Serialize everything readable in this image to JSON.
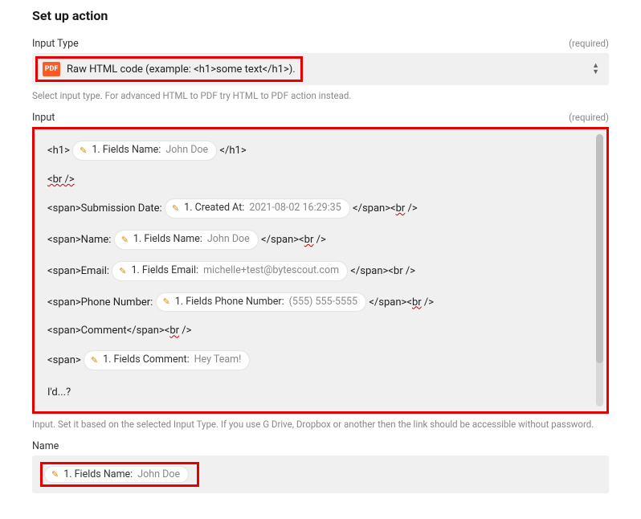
{
  "header": {
    "title": "Set up action"
  },
  "inputType": {
    "label": "Input Type",
    "required": "(required)",
    "badge": "PDF",
    "value": "Raw HTML code (example: <h1>some text</h1>).",
    "helper_pre": "Select input type. For advanced HTML to PDF try ",
    "helper_cap1": "HTML",
    "helper_mid": " to ",
    "helper_cap2": "PDF",
    "helper_post": " action instead."
  },
  "input": {
    "label": "Input",
    "required": "(required)",
    "helper": "Input. Set it based on the selected Input  Type. If you use G Drive, Dropbox or another then the link should be accessible without password.",
    "lines": {
      "l1_open": "<h1>",
      "l1_close": "</h1>",
      "l2": "<br />",
      "l3_open": "<span>Submission Date:",
      "l3_close": "</span><",
      "l3_br": "br",
      "l3_end": " />",
      "l4_open": "<span>Name:",
      "l4_close": "</span><",
      "l4_br": "br",
      "l4_end": " />",
      "l5_open": "<span>Email:",
      "l5_close": "</span><br />",
      "l6_open": "<span>Phone Number:",
      "l6_close": "</span><",
      "l6_br": "br",
      "l6_end": " />",
      "l7": "<span>Comment</span><",
      "l7_br": "br",
      "l7_end": " />",
      "l8_open": "<span>",
      "l9": "I'd...?"
    },
    "pills": {
      "fieldsName": {
        "label": "1. Fields Name:",
        "value": "John Doe"
      },
      "createdAt": {
        "label": "1. Created At:",
        "value": "2021-08-02 16:29:35"
      },
      "fieldsEmail": {
        "label": "1. Fields Email:",
        "value": "michelle+test@bytescout.com"
      },
      "fieldsPhone": {
        "label": "1. Fields Phone Number:",
        "value": "(555) 555-5555"
      },
      "fieldsComment": {
        "label": "1. Fields Comment:",
        "value": "Hey Team!"
      }
    }
  },
  "name": {
    "label": "Name",
    "pill": {
      "label": "1. Fields Name:",
      "value": "John Doe"
    }
  }
}
